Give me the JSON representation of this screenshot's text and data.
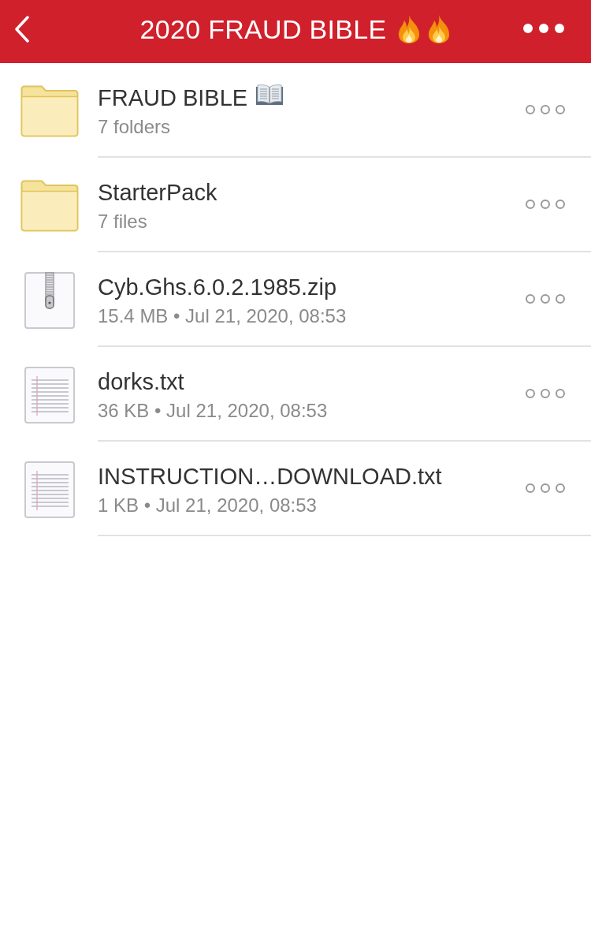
{
  "header": {
    "title": "2020 FRAUD BIBLE",
    "title_icons": [
      {
        "kind": "flame"
      },
      {
        "kind": "flame"
      }
    ]
  },
  "items": [
    {
      "kind": "folder",
      "name": "FRAUD BIBLE",
      "name_icon": {
        "kind": "book"
      },
      "details": "7 folders"
    },
    {
      "kind": "folder",
      "name": "StarterPack",
      "details": "7 files"
    },
    {
      "kind": "zip",
      "name": "Cyb.Ghs.6.0.2.1985.zip",
      "details": "15.4 MB • Jul 21, 2020, 08:53"
    },
    {
      "kind": "text",
      "name": "dorks.txt",
      "details": "36 KB • Jul 21, 2020, 08:53"
    },
    {
      "kind": "text",
      "name": "INSTRUCTION…DOWNLOAD.txt",
      "details": "1 KB • Jul 21, 2020, 08:53"
    }
  ]
}
